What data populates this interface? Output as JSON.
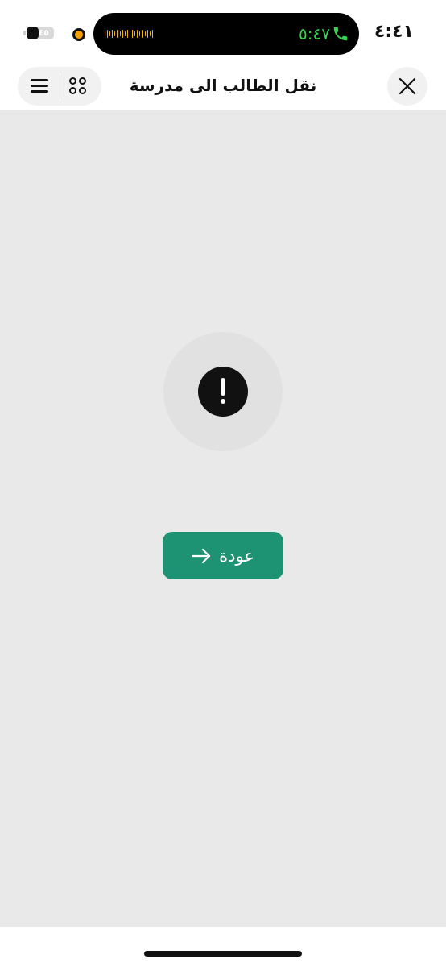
{
  "status_bar": {
    "clock": "٤:٤١",
    "call_timer": "٥:٤٧",
    "battery_level": "٤٥",
    "battery_fraction": 0.45,
    "icons": [
      "phone-icon",
      "recording-indicator",
      "battery-icon"
    ],
    "colors": {
      "call": "#35d34f",
      "waveform": "#f5b400",
      "recording": "#f4a000"
    }
  },
  "header": {
    "title": "نقل الطالب الى مدرسة",
    "icons": [
      "close-icon",
      "apps-icon",
      "menu-icon"
    ]
  },
  "main": {
    "status_icon": "exclamation-icon",
    "back_button_label": "عودة",
    "back_button_icon": "arrow-right-icon",
    "colors": {
      "background": "#e9e9e9",
      "button": "#1d9373"
    }
  }
}
